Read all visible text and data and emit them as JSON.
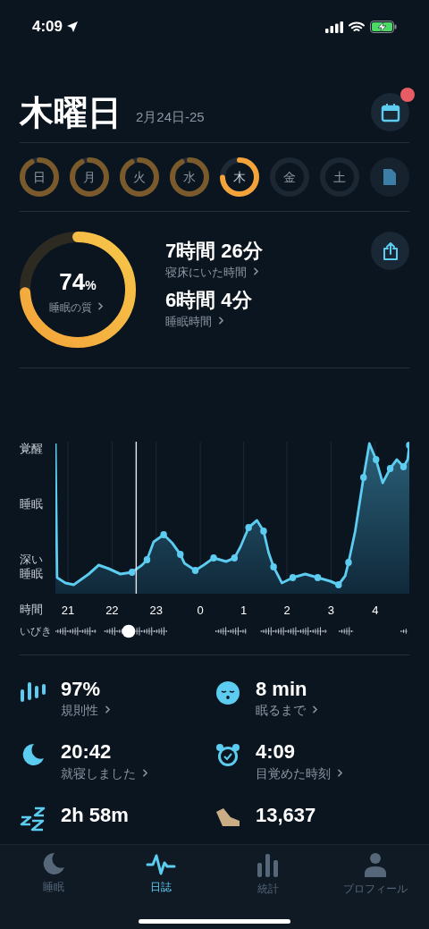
{
  "status_bar": {
    "time": "4:09"
  },
  "header": {
    "title": "木曜日",
    "date": "2月24日-25",
    "notification": true
  },
  "days": [
    {
      "label": "日",
      "recorded": true,
      "selected": false
    },
    {
      "label": "月",
      "recorded": true,
      "selected": false
    },
    {
      "label": "火",
      "recorded": true,
      "selected": false
    },
    {
      "label": "水",
      "recorded": true,
      "selected": false
    },
    {
      "label": "木",
      "recorded": true,
      "selected": true
    },
    {
      "label": "金",
      "recorded": false,
      "selected": false
    },
    {
      "label": "土",
      "recorded": false,
      "selected": false
    }
  ],
  "summary": {
    "quality": {
      "value": "74",
      "unit": "%",
      "label": "睡眠の質"
    },
    "metrics": [
      {
        "value": "7時間 26分",
        "label": "寝床にいた時間"
      },
      {
        "value": "6時間 4分",
        "label": "睡眠時間"
      }
    ]
  },
  "graph": {
    "y_labels": [
      "覚醒",
      "睡眠",
      "深い睡眠"
    ],
    "x_title": "時間",
    "x_labels": [
      "21",
      "22",
      "23",
      "0",
      "1",
      "2",
      "3",
      "4"
    ],
    "snore_label": "いびき"
  },
  "stats": [
    {
      "kind": "bars",
      "value": "97%",
      "label": "規則性"
    },
    {
      "kind": "face",
      "value": "8 min",
      "label": "眠るまで"
    },
    {
      "kind": "moon",
      "value": "20:42",
      "label": "就寝しました"
    },
    {
      "kind": "alarm",
      "value": "4:09",
      "label": "目覚めた時刻"
    },
    {
      "kind": "zzz",
      "value": "2h 58m"
    },
    {
      "kind": "shoe",
      "value": "13,637"
    }
  ],
  "tabs": [
    {
      "kind": "moon",
      "label": "睡眠",
      "selected": false
    },
    {
      "kind": "wave",
      "label": "日誌",
      "selected": true
    },
    {
      "kind": "bars",
      "label": "統計",
      "selected": false
    },
    {
      "kind": "person",
      "label": "プロフィール",
      "selected": false
    }
  ]
}
